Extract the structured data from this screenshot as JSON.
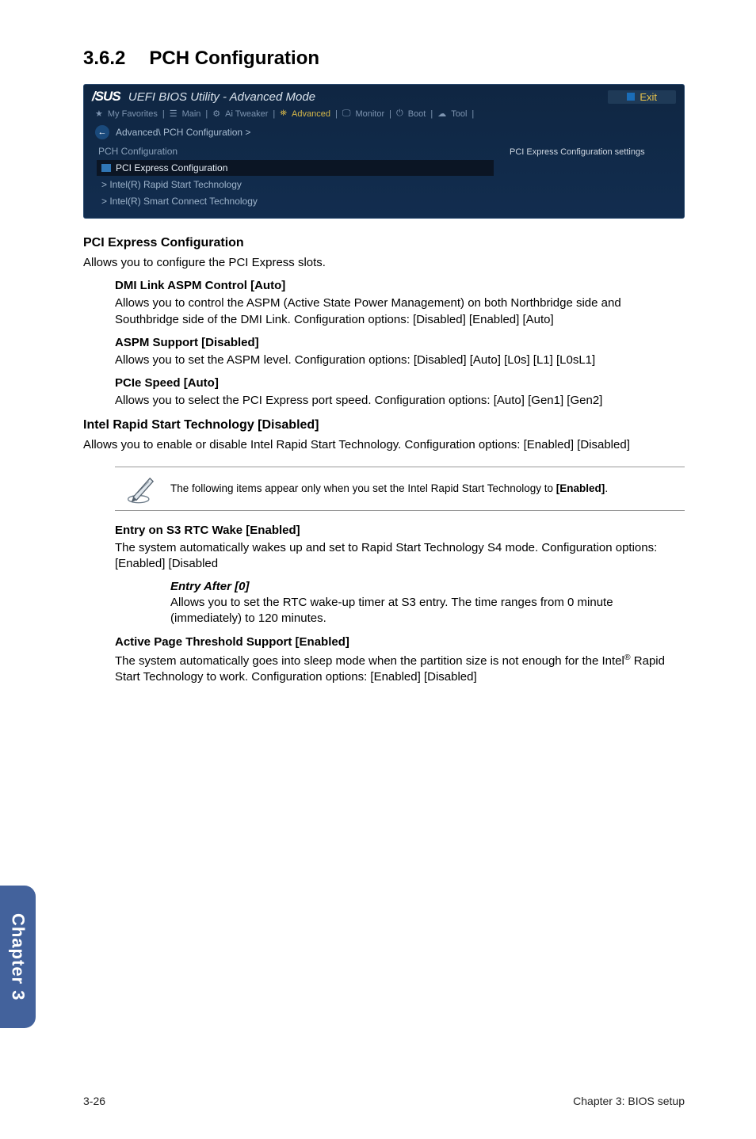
{
  "section": {
    "number": "3.6.2",
    "title": "PCH Configuration"
  },
  "bios": {
    "logo": "/SUS",
    "titlebar": "UEFI BIOS Utility - Advanced Mode",
    "exit": "Exit",
    "tabs": {
      "favorites": "My Favorites",
      "main": "Main",
      "tweaker": "Ai Tweaker",
      "advanced": "Advanced",
      "monitor": "Monitor",
      "boot": "Boot",
      "tool": "Tool"
    },
    "breadcrumb": "Advanced\\ PCH Configuration >",
    "left_heading": "PCH Configuration",
    "items": {
      "pci_express": "PCI Express Configuration",
      "rapid_start": "Intel(R) Rapid Start Technology",
      "smart_connect": "Intel(R) Smart Connect Technology"
    },
    "right_help": "PCI Express Configuration settings"
  },
  "pci_express": {
    "heading": "PCI Express Configuration",
    "intro": "Allows you to configure the PCI Express slots.",
    "dmi": {
      "title": "DMI Link ASPM Control [Auto]",
      "text": "Allows you to control the ASPM (Active State Power Management) on both Northbridge side and Southbridge side of the DMI Link. Configuration options: [Disabled] [Enabled] [Auto]"
    },
    "aspm": {
      "title": "ASPM Support [Disabled]",
      "text": "Allows you to set the ASPM level. Configuration options: [Disabled] [Auto] [L0s] [L1] [L0sL1]"
    },
    "pcie": {
      "title": "PCIe Speed [Auto]",
      "text": "Allows you to select the PCI Express port speed. Configuration options: [Auto] [Gen1] [Gen2]"
    }
  },
  "rapid_start": {
    "heading": "Intel Rapid Start Technology [Disabled]",
    "intro": "Allows you to enable or disable Intel Rapid Start Technology. Configuration options: [Enabled] [Disabled]",
    "note_prefix": "The following items appear only when you set the Intel Rapid Start Technology to ",
    "note_bold": "[Enabled]",
    "note_suffix": ".",
    "entry_s3": {
      "title": "Entry on S3 RTC Wake [Enabled]",
      "text": "The system automatically wakes up and set to Rapid Start Technology S4 mode. Configuration options: [Enabled] [Disabled",
      "entry_after_title": "Entry After [0]",
      "entry_after_text": "Allows you to set the RTC wake-up timer at S3 entry. The time ranges from 0 minute (immediately) to 120 minutes."
    },
    "active_page": {
      "title": "Active Page Threshold Support [Enabled]",
      "text_pre": "The system automatically goes into sleep mode when the partition size is not enough for the Intel",
      "reg": "®",
      "text_post": " Rapid Start Technology to work. Configuration options: [Enabled] [Disabled]"
    }
  },
  "chapter_tab": "Chapter 3",
  "footer": {
    "left": "3-26",
    "right": "Chapter 3: BIOS setup"
  }
}
